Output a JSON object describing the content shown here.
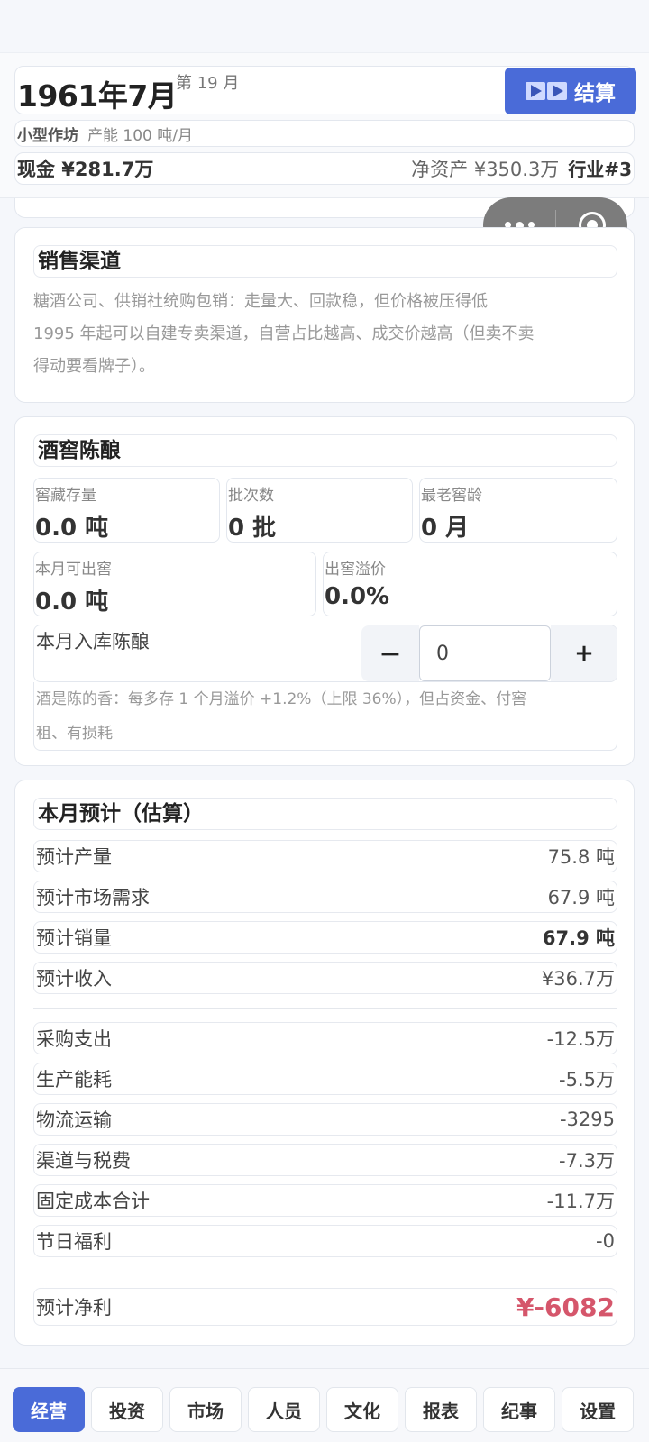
{
  "header": {
    "date": "1961年7月",
    "month_index": "第 19 月",
    "settle_label": "结算",
    "workshop": "小型作坊",
    "capacity": "产能 100 吨/月",
    "cash": "现金 ¥281.7万",
    "net_assets": "净资产 ¥350.3万",
    "rank": "行业#3"
  },
  "sales": {
    "title": "销售渠道",
    "line1": "糖酒公司、供销社统购包销：走量大、回款稳，但价格被压得低",
    "line2": "1995 年起可以自建专卖渠道，自营占比越高、成交价越高（但卖不卖",
    "line3": "得动要看牌子）。"
  },
  "cellar": {
    "title": "酒窖陈酿",
    "stats": [
      {
        "label": "窖藏存量",
        "value": "0.0 吨"
      },
      {
        "label": "批次数",
        "value": "0 批"
      },
      {
        "label": "最老窖龄",
        "value": "0 月"
      },
      {
        "label": "本月可出窖",
        "value": "0.0 吨"
      },
      {
        "label": "出窖溢价",
        "value": "0.0%"
      }
    ],
    "stepper_label": "本月入库陈酿",
    "stepper_value": "0",
    "minus": "−",
    "plus": "+",
    "note1": "酒是陈的香：每多存 1 个月溢价 +1.2%（上限 36%），但占资金、付窖",
    "note2": "租、有损耗"
  },
  "forecast": {
    "title": "本月预计（估算）",
    "rows1": [
      {
        "label": "预计产量",
        "value": "75.8 吨"
      },
      {
        "label": "预计市场需求",
        "value": "67.9 吨"
      },
      {
        "label": "预计销量",
        "value": "67.9 吨"
      },
      {
        "label": "预计收入",
        "value": "¥36.7万"
      }
    ],
    "rows2": [
      {
        "label": "采购支出",
        "value": "-12.5万"
      },
      {
        "label": "生产能耗",
        "value": "-5.5万"
      },
      {
        "label": "物流运输",
        "value": "-3295"
      },
      {
        "label": "渠道与税费",
        "value": "-7.3万"
      },
      {
        "label": "固定成本合计",
        "value": "-11.7万"
      },
      {
        "label": "节日福利",
        "value": "-0"
      }
    ],
    "net_label": "预计净利",
    "net_value": "¥-6082"
  },
  "tabs": [
    "经营",
    "投资",
    "市场",
    "人员",
    "文化",
    "报表",
    "纪事",
    "设置"
  ],
  "colors": {
    "accent": "#4a6bd8",
    "negative": "#d5566b"
  }
}
